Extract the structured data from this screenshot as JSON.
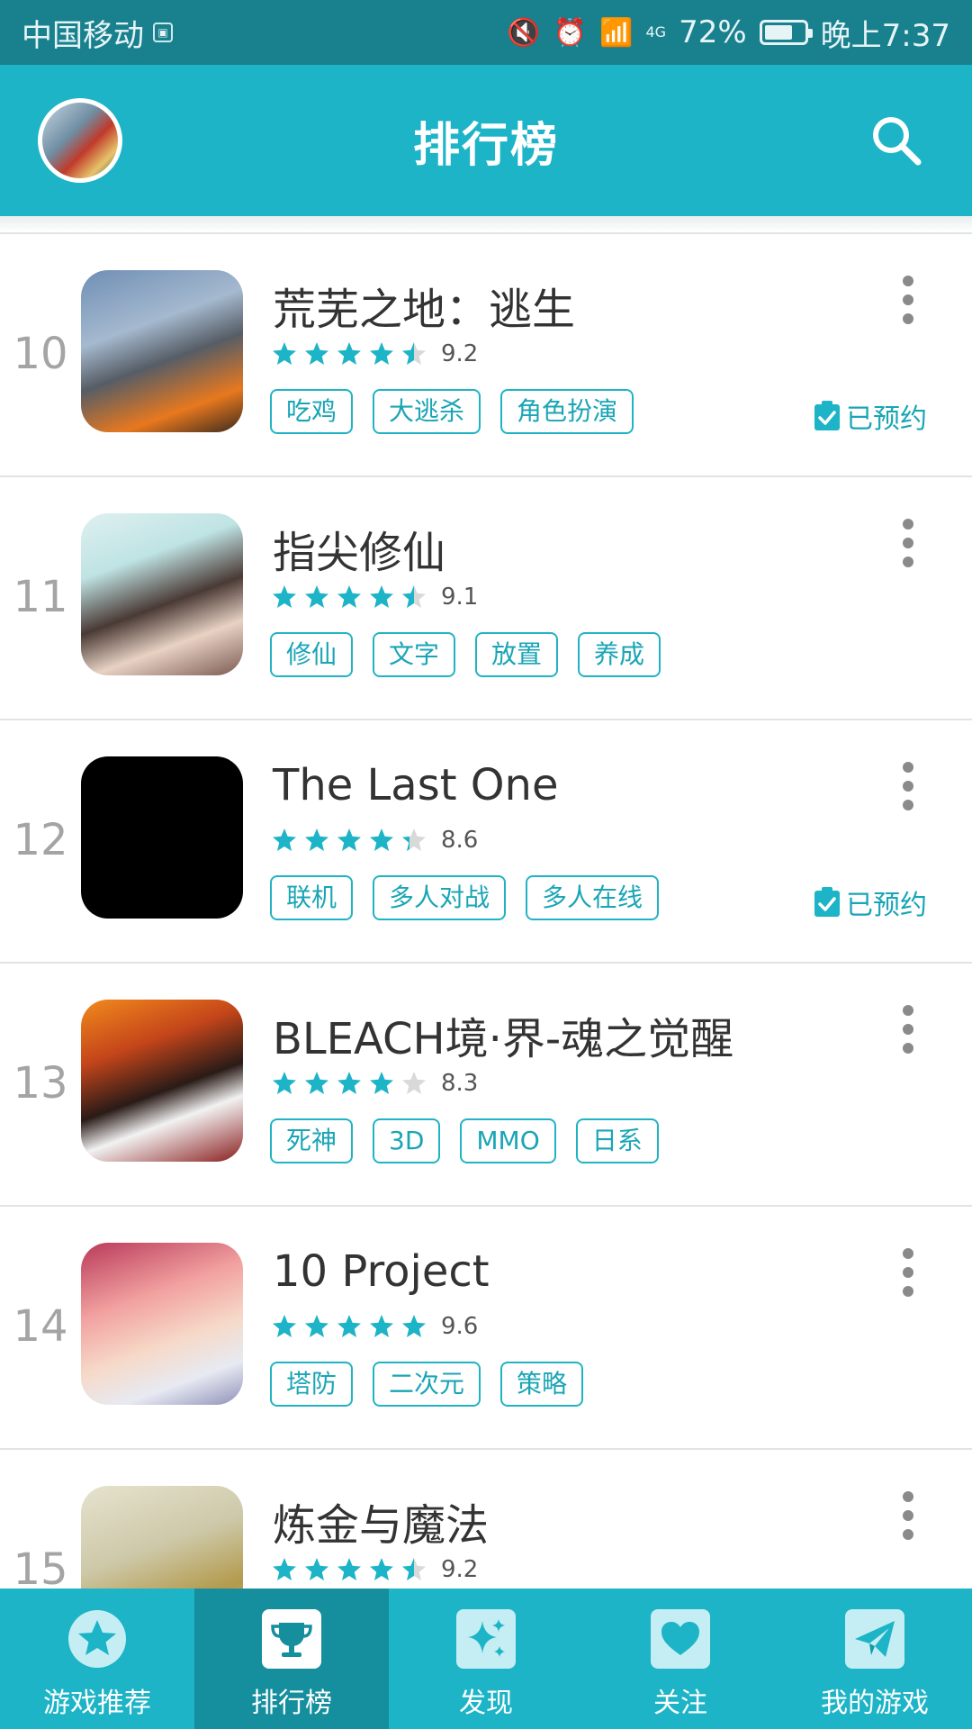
{
  "status_bar": {
    "carrier": "中国移动",
    "network": "4G",
    "battery": "72%",
    "battery_level": 0.72,
    "time": "晚上7:37"
  },
  "header": {
    "title": "排行榜"
  },
  "colors": {
    "accent": "#1cb4c6",
    "accent_dark": "#158e9d",
    "statusbar": "#19808e",
    "star": "#1cb4c6",
    "star_empty": "#d9d9d9"
  },
  "games": [
    {
      "rank": "10",
      "name": "荒芜之地：逃生",
      "rating": 4.5,
      "score": "9.2",
      "tags": [
        "吃鸡",
        "大逃杀",
        "角色扮演"
      ],
      "reserved": "已预约"
    },
    {
      "rank": "11",
      "name": "指尖修仙",
      "rating": 4.5,
      "score": "9.1",
      "tags": [
        "修仙",
        "文字",
        "放置",
        "养成"
      ],
      "reserved": ""
    },
    {
      "rank": "12",
      "name": "The Last One",
      "rating": 4.3,
      "score": "8.6",
      "tags": [
        "联机",
        "多人对战",
        "多人在线"
      ],
      "reserved": "已预约"
    },
    {
      "rank": "13",
      "name": "BLEACH境·界-魂之觉醒",
      "rating": 4.0,
      "score": "8.3",
      "tags": [
        "死神",
        "3D",
        "MMO",
        "日系"
      ],
      "reserved": ""
    },
    {
      "rank": "14",
      "name": "10 Project",
      "rating": 5.0,
      "score": "9.6",
      "tags": [
        "塔防",
        "二次元",
        "策略"
      ],
      "reserved": ""
    },
    {
      "rank": "15",
      "name": "炼金与魔法",
      "rating": 4.5,
      "score": "9.2",
      "tags": [],
      "reserved": ""
    }
  ],
  "bottom_nav": [
    {
      "label": "游戏推荐",
      "icon": "star-icon",
      "active": false
    },
    {
      "label": "排行榜",
      "icon": "trophy-icon",
      "active": true
    },
    {
      "label": "发现",
      "icon": "sparkle-icon",
      "active": false
    },
    {
      "label": "关注",
      "icon": "heart-icon",
      "active": false
    },
    {
      "label": "我的游戏",
      "icon": "paper-plane-icon",
      "active": false
    }
  ]
}
